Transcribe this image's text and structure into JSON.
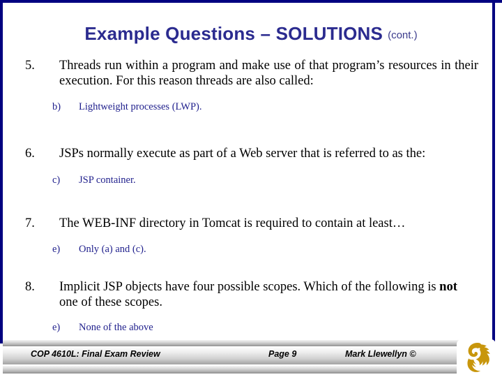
{
  "slide": {
    "title_main": "Example Questions – SOLUTIONS",
    "title_cont": "(cont.)",
    "border_color": "#000080",
    "title_color": "#2b2b8f",
    "answer_color": "#1f1f8c"
  },
  "questions": [
    {
      "number": "5.",
      "text": "Threads run within a program and make use of that program’s resources in their execution.   For this reason threads are also called:",
      "answer_letter": "b)",
      "answer_text": "Lightweight processes (LWP)."
    },
    {
      "number": "6.",
      "text": "JSPs normally execute as part of a Web server that is referred to as the:",
      "answer_letter": "c)",
      "answer_text": "JSP container."
    },
    {
      "number": "7.",
      "text": "The WEB-INF directory in Tomcat is required to contain at least…",
      "answer_letter": "e)",
      "answer_text": "Only (a) and (c)."
    },
    {
      "number": "8.",
      "text_pre": "Implicit JSP objects have four possible scopes.  Which of the following is ",
      "text_bold": "not",
      "text_post": " one of these scopes.",
      "answer_letter": "e)",
      "answer_text": "None of the above"
    }
  ],
  "footer": {
    "course": "COP 4610L: Final Exam Review",
    "page": "Page 9",
    "author": "Mark Llewellyn ©",
    "logo_name": "ucf-pegasus-logo",
    "logo_color": "#C8960C"
  }
}
